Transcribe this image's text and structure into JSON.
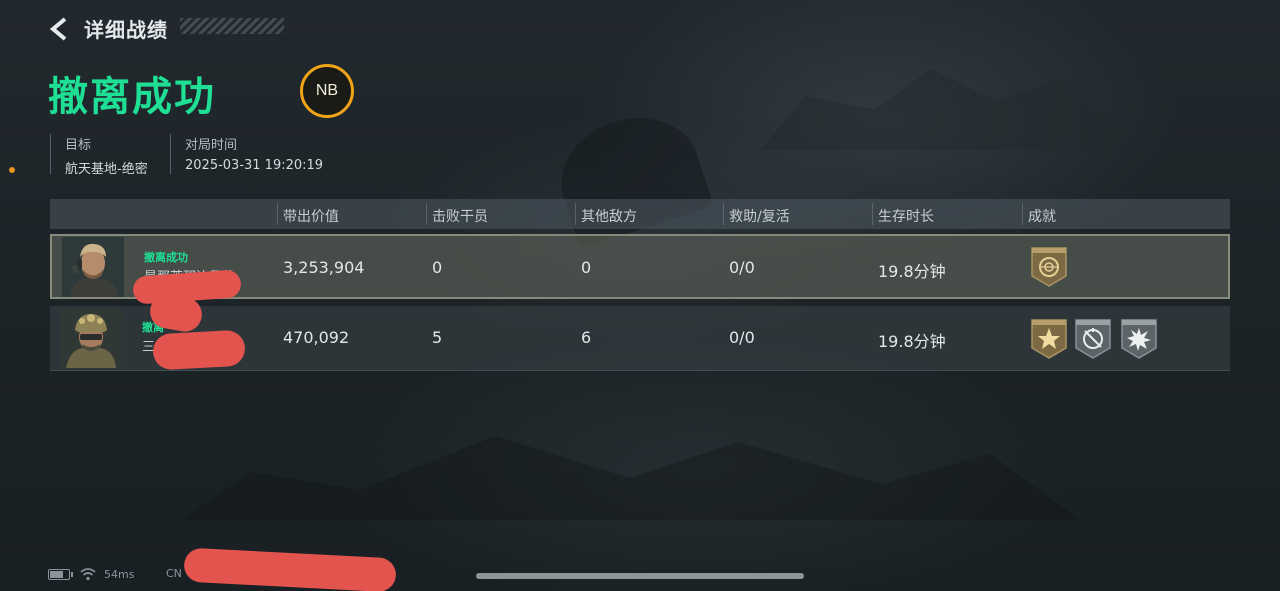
{
  "header": {
    "title": "详细战绩"
  },
  "result": {
    "title": "撤离成功",
    "badge": "NB"
  },
  "info": {
    "target_label": "目标",
    "target_value": "航天基地-绝密",
    "time_label": "对局时间",
    "time_value": "2025-03-31 19:20:19"
  },
  "table": {
    "columns": [
      "",
      "带出价值",
      "击败干员",
      "其他敌方",
      "救助/复活",
      "生存时长",
      "成就"
    ],
    "rows": [
      {
        "status": "撤离成功",
        "name": "是那芙那边日他",
        "value": "3,253,904",
        "defeated_operators": "0",
        "other_enemies": "0",
        "assist_revive": "0/0",
        "survival": "19.8分钟",
        "achievements": [
          "bronze-medal-icon"
        ]
      },
      {
        "status": "撤离",
        "name": "三",
        "value": "470,092",
        "defeated_operators": "5",
        "other_enemies": "6",
        "assist_revive": "0/0",
        "survival": "19.8分钟",
        "achievements": [
          "gold-star-medal-icon",
          "crosshair-medal-icon",
          "burst-medal-icon"
        ]
      }
    ]
  },
  "statusbar": {
    "ping": "54ms",
    "region": "CN"
  },
  "colors": {
    "success": "#1edf94",
    "badge_ring": "#f1a417",
    "accent_dot": "#e8941f"
  }
}
